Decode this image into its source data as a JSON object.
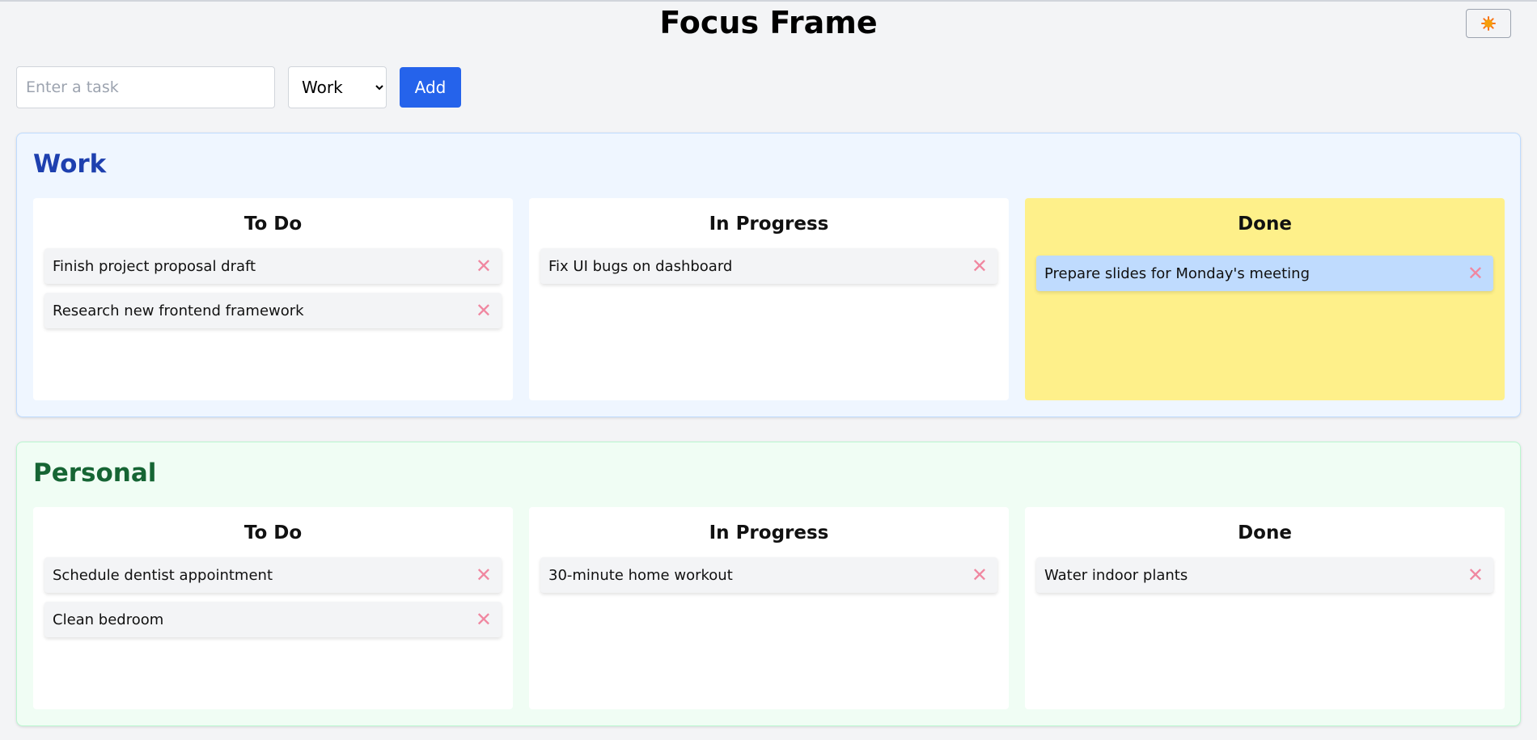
{
  "header": {
    "title": "Focus Frame",
    "theme_icon": "sun-icon"
  },
  "form": {
    "task_placeholder": "Enter a task",
    "task_value": "",
    "category_selected": "Work",
    "category_options": [
      "Work",
      "Personal"
    ],
    "add_label": "Add"
  },
  "colors": {
    "accent": "#2563eb",
    "work_title": "#1e40af",
    "personal_title": "#166534",
    "drop_highlight": "#fef08a",
    "selected_task": "#bfdbfe",
    "delete_icon": "#f087a0"
  },
  "work": {
    "title": "Work",
    "columns": [
      {
        "title": "To Do",
        "tasks": [
          "Finish project proposal draft",
          "Research new frontend framework"
        ]
      },
      {
        "title": "In Progress",
        "tasks": [
          "Fix UI bugs on dashboard"
        ]
      },
      {
        "title": "Done",
        "tasks": [
          "Prepare slides for Monday's meeting"
        ]
      }
    ]
  },
  "personal": {
    "title": "Personal",
    "columns": [
      {
        "title": "To Do",
        "tasks": [
          "Schedule dentist appointment",
          "Clean bedroom"
        ]
      },
      {
        "title": "In Progress",
        "tasks": [
          "30-minute home workout"
        ]
      },
      {
        "title": "Done",
        "tasks": [
          "Water indoor plants"
        ]
      }
    ]
  },
  "delete_symbol": "✕"
}
